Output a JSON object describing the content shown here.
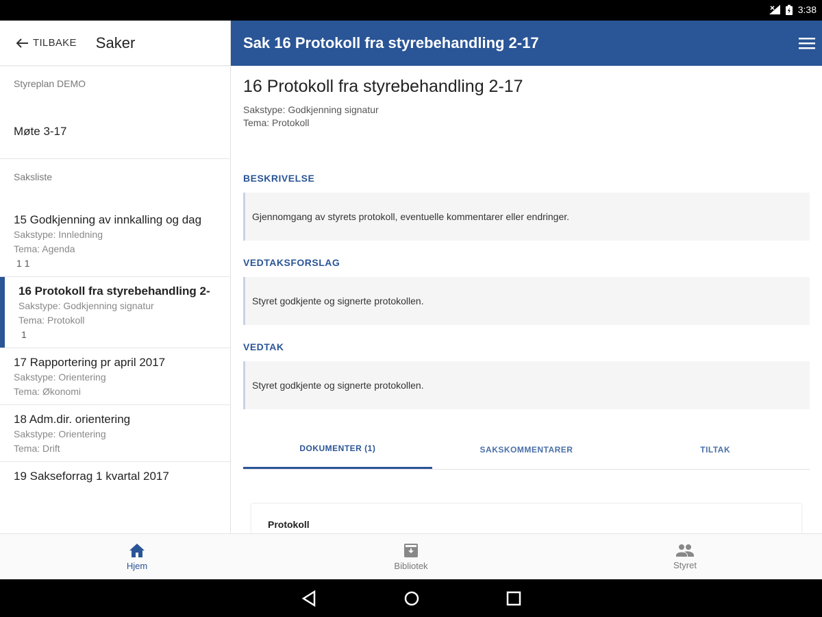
{
  "status_bar": {
    "time": "3:38"
  },
  "left_panel": {
    "back_label": "TILBAKE",
    "title": "Saker",
    "board_name": "Styreplan DEMO",
    "meeting": "Møte 3-17",
    "list_label": "Saksliste",
    "items": [
      {
        "title": "15 Godkjenning av innkalling og dag",
        "type": "Sakstype: Innledning",
        "theme": "Tema: Agenda",
        "extra": "1  1"
      },
      {
        "title": "16 Protokoll fra styrebehandling 2-",
        "type": "Sakstype: Godkjenning signatur",
        "theme": "Tema: Protokoll",
        "extra": "1"
      },
      {
        "title": "17 Rapportering pr april 2017",
        "type": "Sakstype: Orientering",
        "theme": "Tema: Økonomi"
      },
      {
        "title": "18 Adm.dir. orientering",
        "type": "Sakstype: Orientering",
        "theme": "Tema: Drift"
      },
      {
        "title": "19 Sakseforrag 1 kvartal 2017"
      }
    ]
  },
  "right_panel": {
    "header_title": "Sak 16 Protokoll fra styrebehandling 2-17",
    "heading": "16 Protokoll fra styrebehandling 2-17",
    "type": "Sakstype: Godkjenning signatur",
    "theme": "Tema: Protokoll",
    "sections": [
      {
        "title": "BESKRIVELSE",
        "text": "Gjennomgang av styrets protokoll, eventuelle kommentarer eller endringer."
      },
      {
        "title": "VEDTAKSFORSLAG",
        "text": "Styret godkjente og signerte protokollen."
      },
      {
        "title": "VEDTAK",
        "text": "Styret godkjente og signerte protokollen."
      }
    ],
    "tabs": [
      "DOKUMENTER (1)",
      "SAKSKOMMENTARER",
      "TILTAK"
    ],
    "document_title": "Protokoll"
  },
  "bottom_nav": [
    "Hjem",
    "Bibliotek",
    "Styret"
  ],
  "colors": {
    "primary": "#2a5596"
  }
}
